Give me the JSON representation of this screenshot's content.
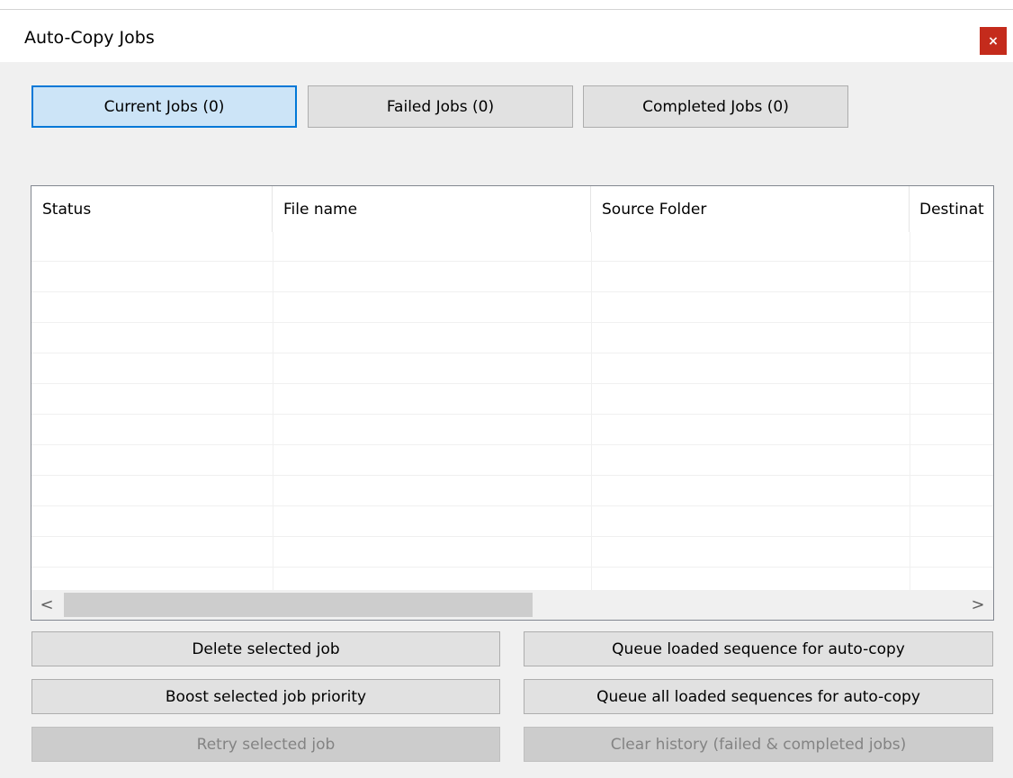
{
  "window": {
    "title": "Auto-Copy Jobs",
    "close_label": "×"
  },
  "tabs": [
    {
      "label": "Current Jobs (0)",
      "active": true
    },
    {
      "label": "Failed Jobs (0)",
      "active": false
    },
    {
      "label": "Completed Jobs (0)",
      "active": false
    }
  ],
  "list": {
    "columns": [
      "Status",
      "File name",
      "Source Folder",
      "Destinat"
    ],
    "rows": []
  },
  "scrollbar": {
    "left_arrow": "<",
    "right_arrow": ">"
  },
  "buttons": {
    "delete": "Delete selected job",
    "boost": "Boost selected job priority",
    "retry": "Retry selected job",
    "queue_loaded": "Queue loaded sequence for auto-copy",
    "queue_all": "Queue all loaded sequences for auto-copy",
    "clear_history": "Clear history (failed & completed jobs)"
  },
  "colors": {
    "accent": "#0078d7",
    "active_tab_bg": "#cce4f7",
    "close_bg": "#c42b1c"
  }
}
